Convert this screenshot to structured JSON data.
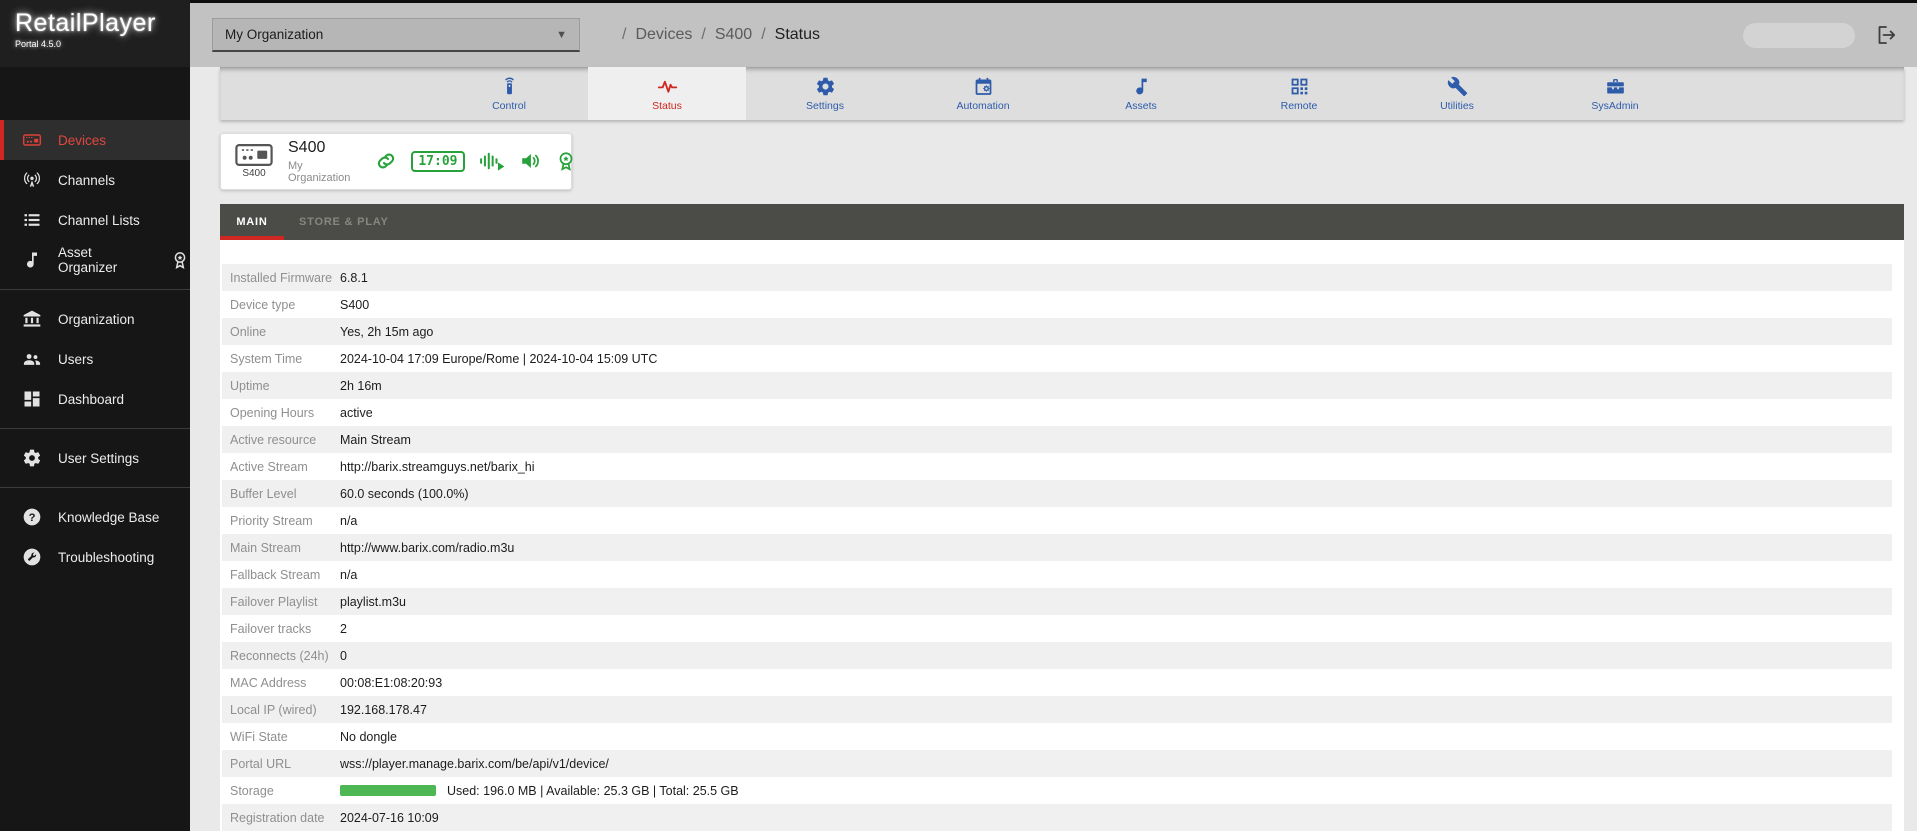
{
  "header": {
    "logo_title": "RetailPlayer",
    "logo_subtitle": "Portal 4.5.0",
    "org_selector_value": "My Organization",
    "breadcrumb": [
      "Devices",
      "S400",
      "Status"
    ]
  },
  "sidebar": {
    "sections": [
      {
        "items": [
          {
            "label": "Devices",
            "icon": "device-icon",
            "active": true
          },
          {
            "label": "Channels",
            "icon": "broadcast-icon"
          },
          {
            "label": "Channel Lists",
            "icon": "list-icon"
          },
          {
            "label": "Asset Organizer",
            "icon": "music-note-icon",
            "badge_icon": "award-icon"
          }
        ]
      },
      {
        "items": [
          {
            "label": "Organization",
            "icon": "bank-icon"
          },
          {
            "label": "Users",
            "icon": "users-icon"
          },
          {
            "label": "Dashboard",
            "icon": "dashboard-icon"
          }
        ]
      },
      {
        "items": [
          {
            "label": "User Settings",
            "icon": "gear-icon"
          }
        ]
      },
      {
        "items": [
          {
            "label": "Knowledge Base",
            "icon": "help-circle-icon"
          },
          {
            "label": "Troubleshooting",
            "icon": "wrench-circle-icon"
          }
        ]
      }
    ]
  },
  "device_tabs": [
    {
      "label": "Control",
      "icon": "remote-icon",
      "active": false
    },
    {
      "label": "Status",
      "icon": "pulse-icon",
      "active": true
    },
    {
      "label": "Settings",
      "icon": "gear-icon",
      "active": false
    },
    {
      "label": "Automation",
      "icon": "calendar-gear-icon",
      "active": false
    },
    {
      "label": "Assets",
      "icon": "music-note-icon",
      "active": false
    },
    {
      "label": "Remote",
      "icon": "qr-code-icon",
      "active": false
    },
    {
      "label": "Utilities",
      "icon": "wrench-icon",
      "active": false
    },
    {
      "label": "SysAdmin",
      "icon": "toolbox-icon",
      "active": false
    }
  ],
  "device_card": {
    "device_type_caption": "S400",
    "title": "S400",
    "subtitle": "My Organization",
    "status_icons": [
      {
        "icon": "link-icon"
      },
      {
        "icon": "clock-display",
        "text": "17:09"
      },
      {
        "icon": "audio-playing-icon"
      },
      {
        "icon": "speaker-icon"
      },
      {
        "icon": "registered-badge-icon"
      }
    ]
  },
  "subtabs": [
    {
      "label": "MAIN",
      "active": true
    },
    {
      "label": "STORE & PLAY",
      "active": false
    }
  ],
  "status_table": {
    "rows": [
      {
        "label": "Installed Firmware",
        "value": "6.8.1"
      },
      {
        "label": "Device type",
        "value": "S400"
      },
      {
        "label": "Online",
        "value": "Yes, 2h 15m ago"
      },
      {
        "label": "System Time",
        "value": "2024-10-04 17:09 Europe/Rome | 2024-10-04 15:09 UTC"
      },
      {
        "label": "Uptime",
        "value": "2h 16m"
      },
      {
        "label": "Opening Hours",
        "value": "active"
      },
      {
        "label": "Active resource",
        "value": "Main Stream"
      },
      {
        "label": "Active Stream",
        "value": "http://barix.streamguys.net/barix_hi"
      },
      {
        "label": "Buffer Level",
        "value": "60.0 seconds (100.0%)"
      },
      {
        "label": "Priority Stream",
        "value": "n/a"
      },
      {
        "label": "Main Stream",
        "value": "http://www.barix.com/radio.m3u"
      },
      {
        "label": "Fallback Stream",
        "value": "n/a"
      },
      {
        "label": "Failover Playlist",
        "value": "playlist.m3u"
      },
      {
        "label": "Failover tracks",
        "value": "2"
      },
      {
        "label": "Reconnects (24h)",
        "value": "0"
      },
      {
        "label": "MAC Address",
        "value": "00:08:E1:08:20:93"
      },
      {
        "label": "Local IP (wired)",
        "value": "192.168.178.47"
      },
      {
        "label": "WiFi State",
        "value": "No dongle"
      },
      {
        "label": "Portal URL",
        "value": "wss://player.manage.barix.com/be/api/v1/device/"
      },
      {
        "label": "Storage",
        "value": "Used: 196.0 MB | Available: 25.3 GB | Total: 25.5 GB",
        "progress_bar": true
      },
      {
        "label": "Registration date",
        "value": "2024-07-16 10:09"
      }
    ]
  },
  "colors": {
    "accent_red": "#cf2721",
    "tab_blue": "#2e5cab",
    "status_green": "#27a23a",
    "storage_bar_green": "#4db853"
  }
}
